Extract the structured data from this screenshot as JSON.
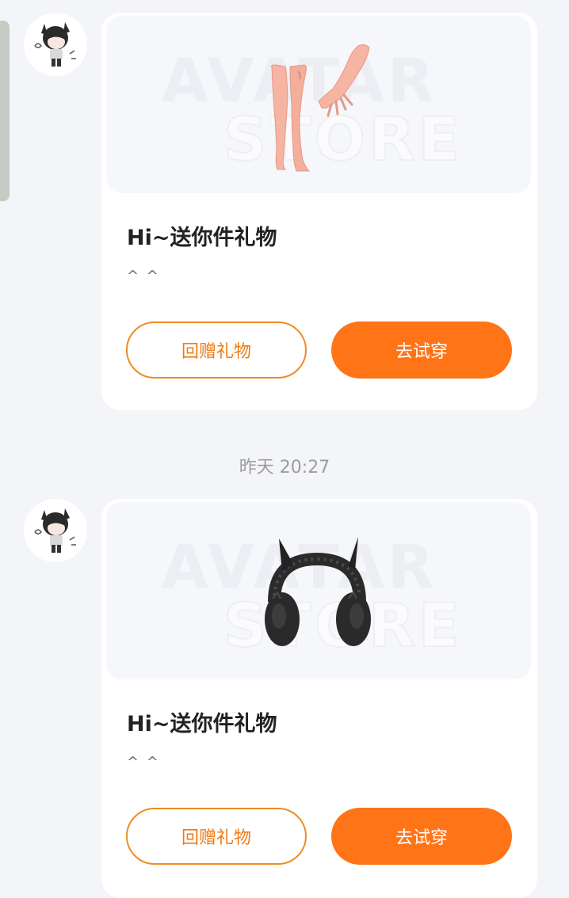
{
  "messages": [
    {
      "avatar_icon": "cat-boy-avatar",
      "gift_item": "pale-legs-and-hand-wearable",
      "watermark_line1": "AVATAR",
      "watermark_line2": "STORE",
      "title": "Hi~送你件礼物",
      "subtitle": "^ ^",
      "return_gift_label": "回赠礼物",
      "try_on_label": "去试穿"
    },
    {
      "avatar_icon": "cat-boy-avatar",
      "gift_item": "black-horned-headphones",
      "watermark_line1": "AVATAR",
      "watermark_line2": "STORE",
      "title": "Hi~送你件礼物",
      "subtitle": "^ ^",
      "return_gift_label": "回赠礼物",
      "try_on_label": "去试穿"
    }
  ],
  "timestamp": "昨天 20:27",
  "colors": {
    "accent": "#ff7417",
    "accent_outline": "#f08b24",
    "background": "#f4f5f8",
    "card": "#ffffff"
  }
}
